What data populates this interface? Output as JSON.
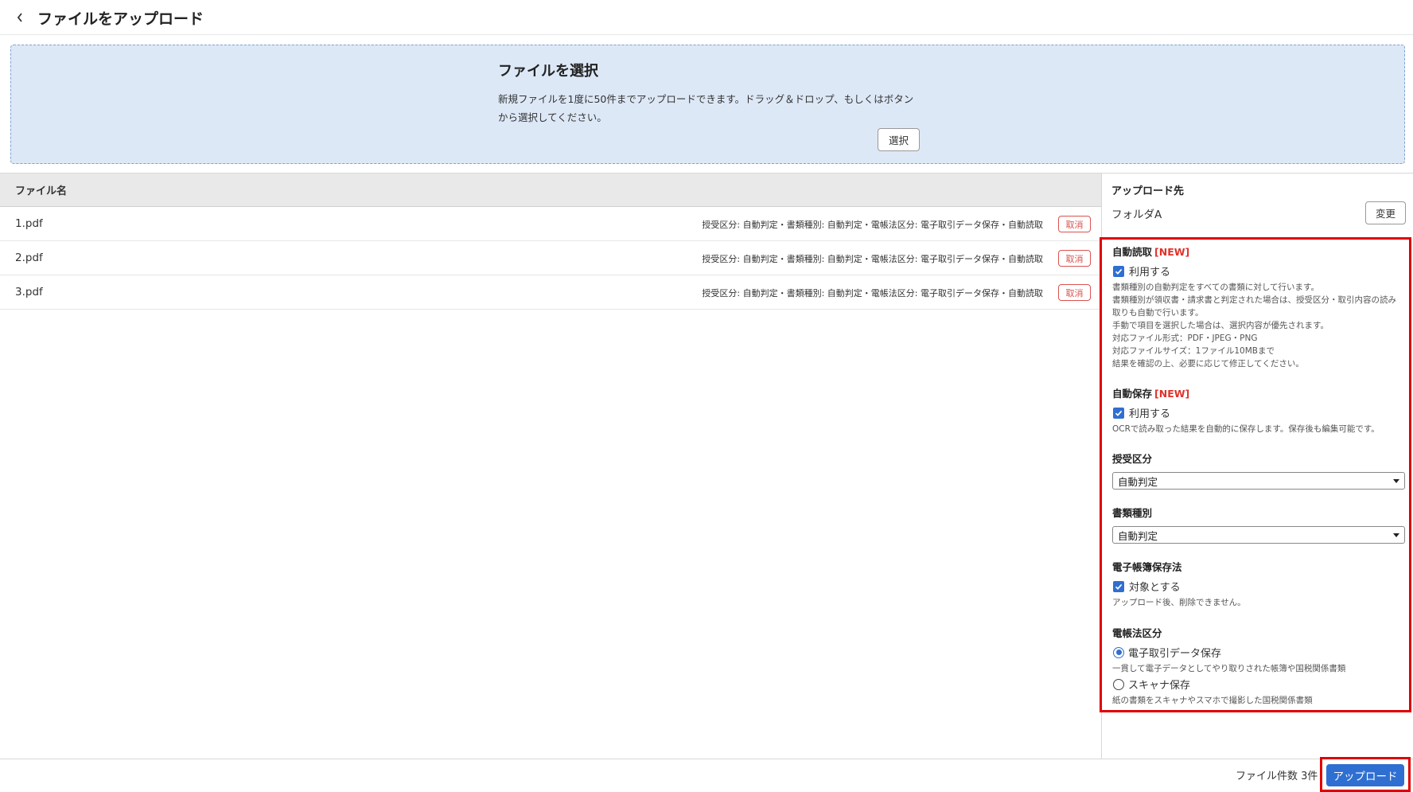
{
  "header": {
    "title": "ファイルをアップロード",
    "back_icon": "chevron-left-icon"
  },
  "dropzone": {
    "title": "ファイルを選択",
    "description_line1": "新規ファイルを1度に50件までアップロードできます。ドラッグ＆ドロップ、もしくはボタン",
    "description_line2": "から選択してください。",
    "select_label": "選択"
  },
  "table": {
    "column_filename": "ファイル名",
    "rows": [
      {
        "name": "1.pdf",
        "meta": "授受区分: 自動判定・書類種別: 自動判定・電帳法区分: 電子取引データ保存・自動読取",
        "cancel": "取消"
      },
      {
        "name": "2.pdf",
        "meta": "授受区分: 自動判定・書類種別: 自動判定・電帳法区分: 電子取引データ保存・自動読取",
        "cancel": "取消"
      },
      {
        "name": "3.pdf",
        "meta": "授受区分: 自動判定・書類種別: 自動判定・電帳法区分: 電子取引データ保存・自動読取",
        "cancel": "取消"
      }
    ]
  },
  "destination": {
    "title": "アップロード先",
    "folder": "フォルダA",
    "change_label": "変更"
  },
  "settings": {
    "auto_read": {
      "title": "自動読取",
      "new_tag": "[NEW]",
      "checkbox_label": "利用する",
      "checked": true,
      "desc": [
        "書類種別の自動判定をすべての書類に対して行います。",
        "書類種別が領収書・請求書と判定された場合は、授受区分・取引内容の読み",
        "取りも自動で行います。",
        "手動で項目を選択した場合は、選択内容が優先されます。",
        "対応ファイル形式：PDF・JPEG・PNG",
        "対応ファイルサイズ：1ファイル10MBまで",
        "結果を確認の上、必要に応じて修正してください。"
      ]
    },
    "auto_save": {
      "title": "自動保存",
      "new_tag": "[NEW]",
      "checkbox_label": "利用する",
      "checked": true,
      "desc": "OCRで読み取った結果を自動的に保存します。保存後も編集可能です。"
    },
    "exchange_type": {
      "title": "授受区分",
      "selected": "自動判定"
    },
    "document_type": {
      "title": "書類種別",
      "selected": "自動判定"
    },
    "ebook_law": {
      "title": "電子帳簿保存法",
      "checkbox_label": "対象とする",
      "checked": true,
      "desc": "アップロード後、削除できません。"
    },
    "ebook_category": {
      "title": "電帳法区分",
      "options": [
        {
          "label": "電子取引データ保存",
          "desc": "一貫して電子データとしてやり取りされた帳簿や国税関係書類",
          "selected": true
        },
        {
          "label": "スキャナ保存",
          "desc": "紙の書類をスキャナやスマホで撮影した国税関係書類",
          "selected": false
        }
      ]
    }
  },
  "footer": {
    "file_count": "ファイル件数 3件",
    "upload_label": "アップロード"
  },
  "colors": {
    "accent": "#2f6fd1",
    "danger": "#d9534f",
    "highlight": "#e00000",
    "dropzone_bg": "#dde8f7"
  }
}
